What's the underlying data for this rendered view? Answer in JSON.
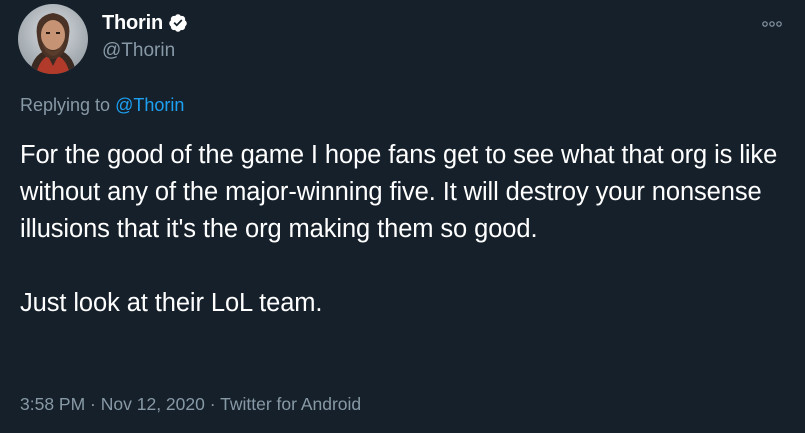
{
  "colors": {
    "background": "#15202b",
    "text_primary": "#ffffff",
    "text_secondary": "#8899a6",
    "link": "#1da1f2",
    "verified_badge": "#ffffff"
  },
  "author": {
    "avatar_icon": "profile-photo",
    "display_name": "Thorin",
    "verified_icon": "verified-badge-icon",
    "handle": "@Thorin"
  },
  "menu": {
    "more_icon": "more-options-icon"
  },
  "reply": {
    "prefix": "Replying to ",
    "handle": "@Thorin"
  },
  "tweet": {
    "text": "For the good of the game I hope fans get to see what that org is like without any of the major-winning five. It will destroy your nonsense illusions that it's the org making them so good.\n\nJust look at their LoL team."
  },
  "meta": {
    "time": "3:58 PM",
    "separator": " · ",
    "date": "Nov 12, 2020",
    "source": "Twitter for Android"
  }
}
